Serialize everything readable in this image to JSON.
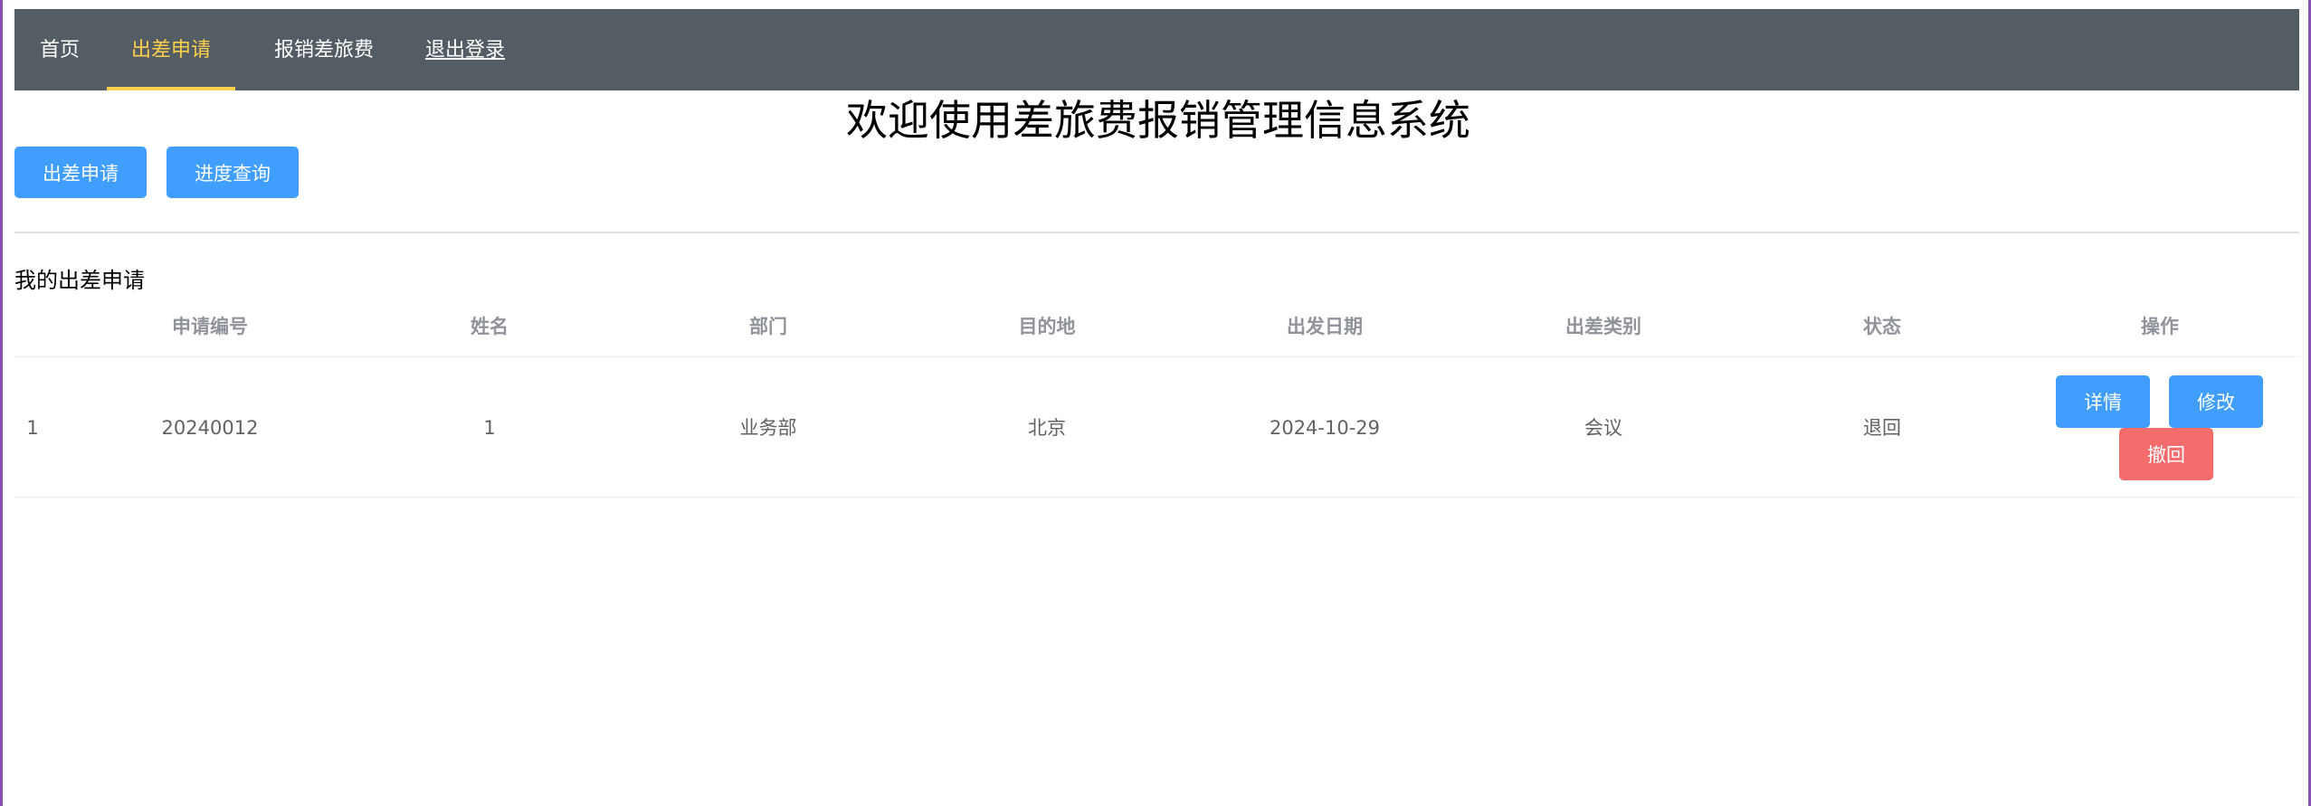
{
  "nav": {
    "items": [
      {
        "label": "首页"
      },
      {
        "label": "出差申请"
      },
      {
        "label": "报销差旅费"
      },
      {
        "label": "退出登录"
      }
    ]
  },
  "page": {
    "title": "欢迎使用差旅费报销管理信息系统"
  },
  "actions": {
    "apply_label": "出差申请",
    "progress_label": "进度查询"
  },
  "section": {
    "title": "我的出差申请"
  },
  "table": {
    "columns": [
      "",
      "申请编号",
      "姓名",
      "部门",
      "目的地",
      "出发日期",
      "出差类别",
      "状态",
      "操作"
    ],
    "rows": [
      {
        "index": "1",
        "application_no": "20240012",
        "name": "1",
        "department": "业务部",
        "destination": "北京",
        "departure_date": "2024-10-29",
        "category": "会议",
        "status": "退回",
        "buttons": {
          "detail": "详情",
          "edit": "修改",
          "withdraw": "撤回"
        }
      }
    ]
  },
  "colors": {
    "navbar_bg": "#545c64",
    "nav_active": "#ffd04b",
    "primary": "#409eff",
    "danger": "#f56c6c",
    "window_border": "#8a4fb5"
  }
}
